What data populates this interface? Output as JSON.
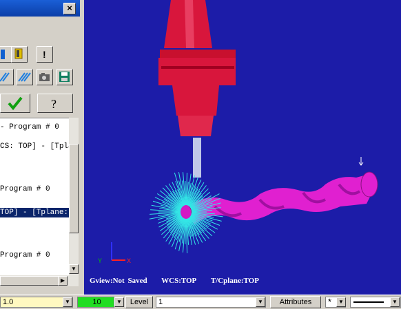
{
  "panel": {
    "close_glyph": "×",
    "operations": [
      {
        "text": "- Program # 0",
        "selected": false
      },
      {
        "text": "CS: TOP] - [Tpla",
        "selected": false
      },
      {
        "text": "Program # 0",
        "selected": false
      },
      {
        "text": "TOP] - [Tplane:",
        "selected": true
      },
      {
        "text": "Program # 0",
        "selected": false
      }
    ]
  },
  "viewport": {
    "gview": "Gview:Not Saved",
    "wcs": "WCS:TOP",
    "tcplane": "T/Cplane:TOP",
    "background": "#1c1ca8"
  },
  "bottombar": {
    "z_value": "1.0",
    "color_value": "10",
    "level_label": "Level",
    "level_value": "1",
    "attributes_label": "Attributes",
    "point_style": "*"
  },
  "colors": {
    "tool_holder": "#d8163c",
    "toolpath": "#33e6e6",
    "part": "#e020d0"
  }
}
